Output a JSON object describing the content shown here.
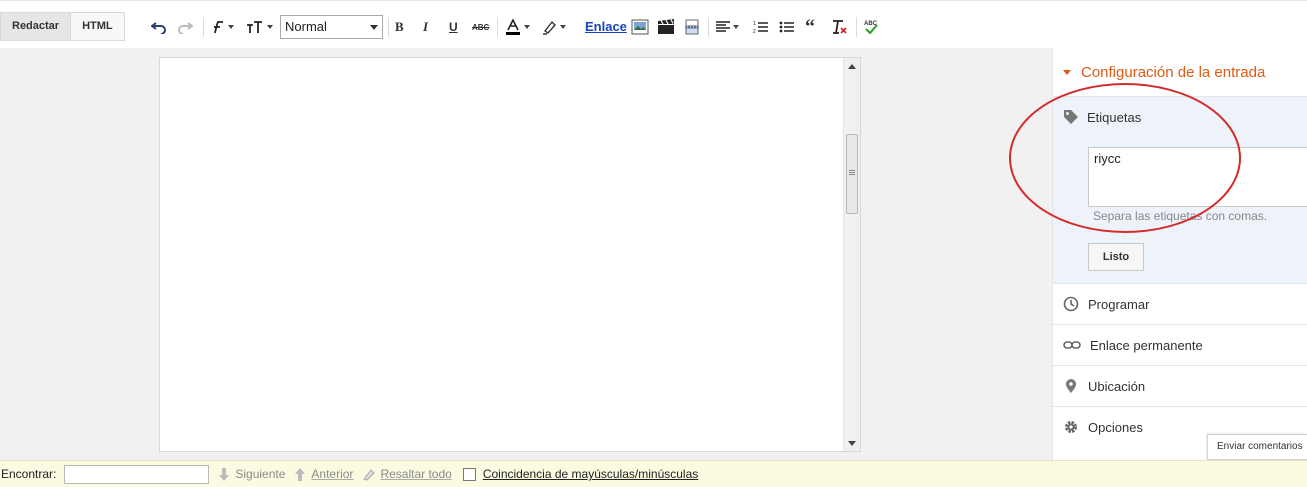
{
  "toolbar": {
    "mode_compose": "Redactar",
    "mode_html": "HTML",
    "format_value": "Normal",
    "link_label": "Enlace"
  },
  "sidebar": {
    "title": "Configuración de la entrada",
    "tags": {
      "heading": "Etiquetas",
      "value": "riycc",
      "hint": "Separa las etiquetas con comas.",
      "done_label": "Listo"
    },
    "items": [
      {
        "label": "Programar",
        "icon": "clock-icon"
      },
      {
        "label": "Enlace permanente",
        "icon": "link-icon"
      },
      {
        "label": "Ubicación",
        "icon": "location-pin-icon"
      },
      {
        "label": "Opciones",
        "icon": "gear-icon"
      }
    ],
    "feedback_label": "Enviar comentarios"
  },
  "findbar": {
    "label": "Encontrar:",
    "next": "Siguiente",
    "previous": "Anterior",
    "highlight_all": "Resaltar todo",
    "match_case": "Coincidencia de mayúsculas/minúsculas"
  },
  "colors": {
    "accent": "#dd5a13",
    "annotation": "#d42a2a",
    "link": "#1a44b8",
    "findbar_bg": "#fbfbe2",
    "panel_bg": "#eef3fa"
  }
}
